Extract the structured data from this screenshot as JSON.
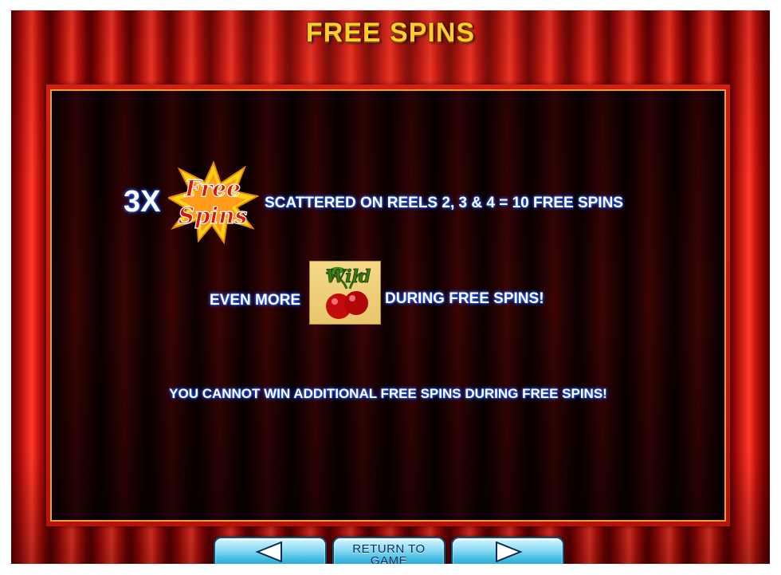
{
  "screen": {
    "title": "FREE SPINS"
  },
  "rules": {
    "multiplier": "3X",
    "scatter_text": "SCATTERED ON REELS 2, 3 & 4 = 10 FREE SPINS",
    "wild_prefix": "EVEN MORE",
    "wild_suffix": "DURING FREE SPINS!",
    "no_retrigger": "YOU CANNOT WIN ADDITIONAL FREE SPINS DURING FREE SPINS!"
  },
  "icons": {
    "free_spins_symbol": {
      "name": "free-spins-symbol-icon",
      "line1": "Free",
      "line2": "Spins"
    },
    "wild_symbol": {
      "name": "wild-cherries-symbol-icon",
      "label": "Wild"
    },
    "prev": "left-arrow-icon",
    "next": "right-arrow-icon"
  },
  "navigation": {
    "return_label": "RETURN TO GAME"
  },
  "colors": {
    "title": "#ffcc2e",
    "text": "#ffffff",
    "text_glow": "#1a4dff",
    "curtain": "#e1251b",
    "panel_border": "#e0a23a",
    "button": "#38b6df"
  }
}
